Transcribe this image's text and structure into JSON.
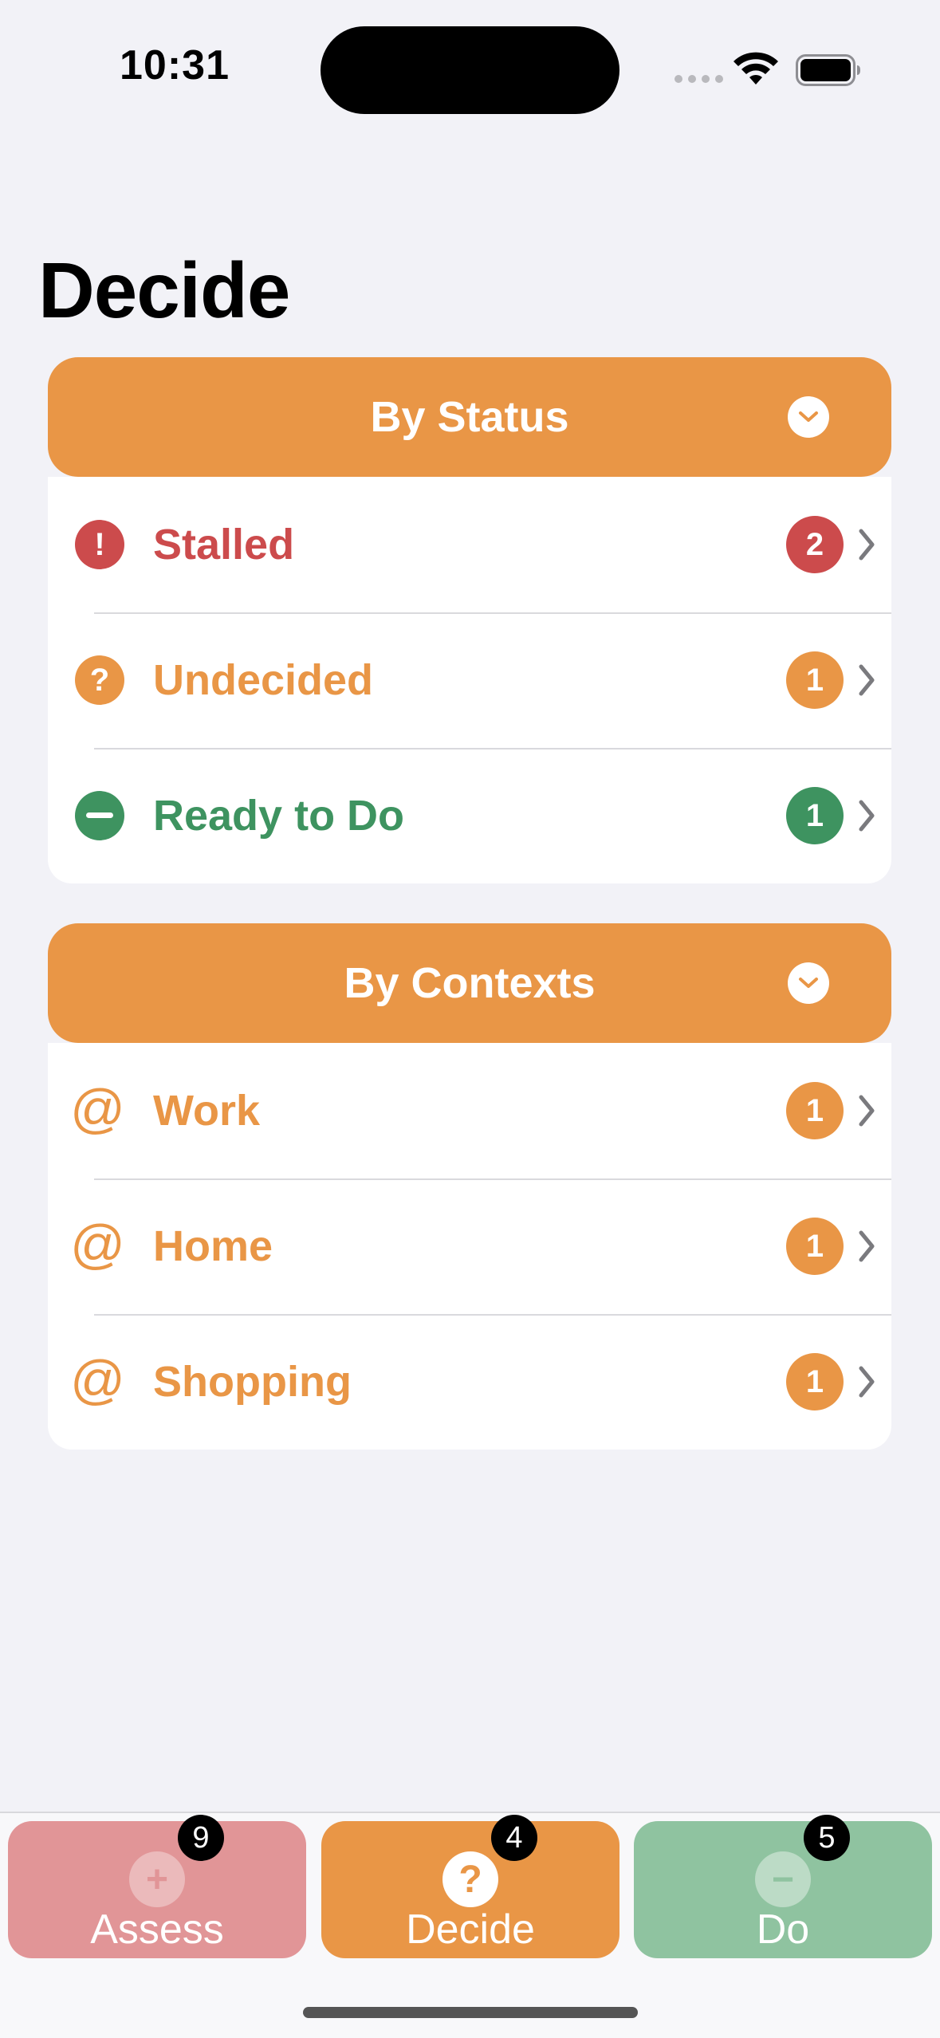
{
  "status_bar": {
    "time": "10:31"
  },
  "page": {
    "title": "Decide"
  },
  "colors": {
    "accent": "#e99646",
    "stalled": "#cc4b4c",
    "undecided": "#e99646",
    "ready": "#3e9360",
    "assess_tab": "#e19597",
    "decide_tab": "#e99646",
    "do_tab": "#8fc3a0"
  },
  "sections": {
    "status": {
      "label": "By Status",
      "rows": [
        {
          "label": "Stalled",
          "count": "2",
          "icon": "exclamation-icon",
          "glyph": "!"
        },
        {
          "label": "Undecided",
          "count": "1",
          "icon": "question-icon",
          "glyph": "?"
        },
        {
          "label": "Ready to Do",
          "count": "1",
          "icon": "minus-icon",
          "glyph": ""
        }
      ]
    },
    "contexts": {
      "label": "By Contexts",
      "rows": [
        {
          "label": "Work",
          "count": "1",
          "icon": "at-icon",
          "glyph": "@"
        },
        {
          "label": "Home",
          "count": "1",
          "icon": "at-icon",
          "glyph": "@"
        },
        {
          "label": "Shopping",
          "count": "1",
          "icon": "at-icon",
          "glyph": "@"
        }
      ]
    }
  },
  "tabs": [
    {
      "label": "Assess",
      "badge": "9",
      "icon": "plus-icon",
      "glyph": "+"
    },
    {
      "label": "Decide",
      "badge": "4",
      "icon": "question-icon",
      "glyph": "?"
    },
    {
      "label": "Do",
      "badge": "5",
      "icon": "minus-icon",
      "glyph": "−"
    }
  ]
}
